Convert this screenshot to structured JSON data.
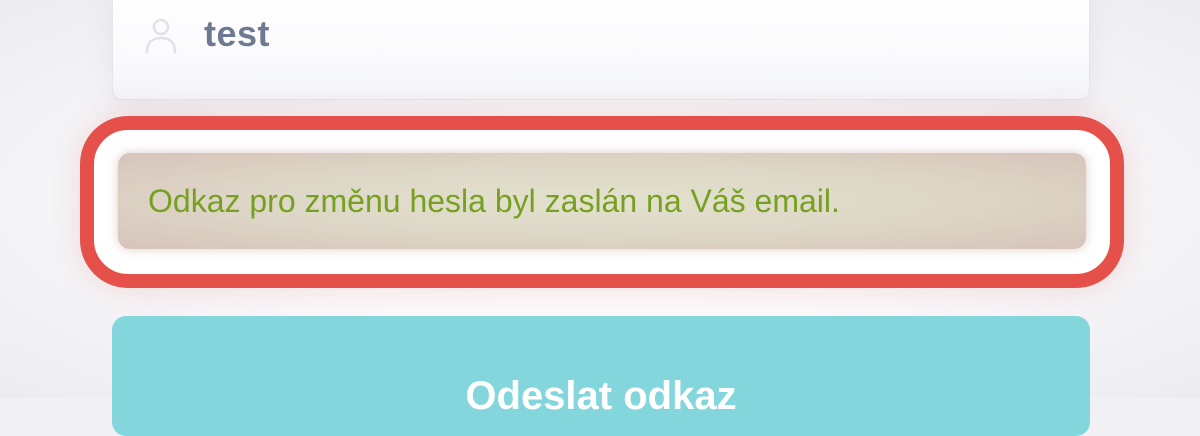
{
  "username_field": {
    "value": "test",
    "icon": "user-icon"
  },
  "alert": {
    "message": "Odkaz pro změnu hesla byl zaslán na Váš email.",
    "text_color": "#77a022",
    "highlight_color": "#e6504a"
  },
  "submit": {
    "label": "Odeslat odkaz",
    "color": "#82d6dc"
  }
}
